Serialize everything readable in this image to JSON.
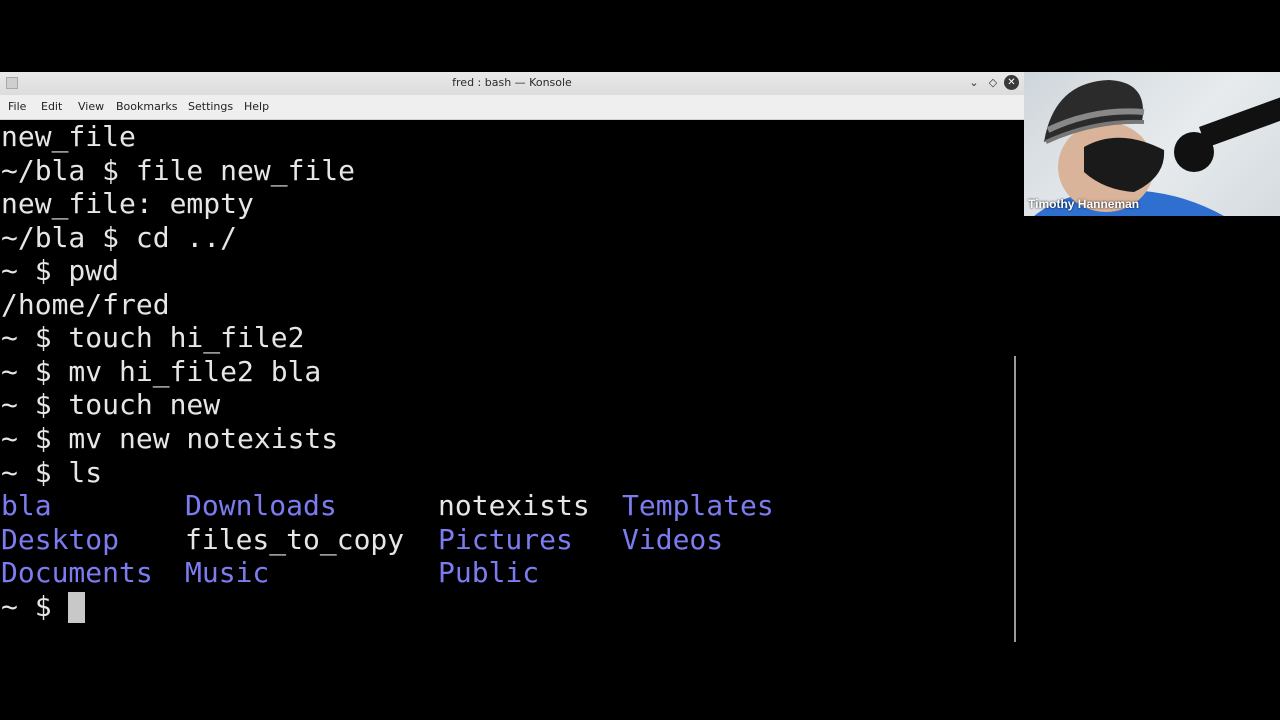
{
  "window": {
    "title": "fred : bash — Konsole",
    "controls": [
      "minimize-icon",
      "maximize-icon",
      "close-icon"
    ]
  },
  "menubar": [
    "File",
    "Edit",
    "View",
    "Bookmarks",
    "Settings",
    "Help"
  ],
  "terminal": {
    "lines": [
      "new_file",
      "~/bla $ file new_file",
      "new_file: empty",
      "~/bla $ cd ../",
      "~ $ pwd",
      "/home/fred",
      "~ $ touch hi_file2",
      "~ $ mv hi_file2 bla",
      "~ $ touch new",
      "~ $ mv new notexists",
      "~ $ ls"
    ],
    "ls_output": [
      [
        "bla",
        "Downloads",
        "notexists",
        "Templates"
      ],
      [
        "Desktop",
        "files_to_copy",
        "Pictures",
        "Videos"
      ],
      [
        "Documents",
        "Music",
        "",
        "Public"
      ]
    ],
    "prompt": "~ $ ",
    "colors": {
      "dir": "#7c7cf0",
      "file": "#e6e6e6"
    }
  },
  "webcam": {
    "name": "Timothy Hanneman"
  }
}
